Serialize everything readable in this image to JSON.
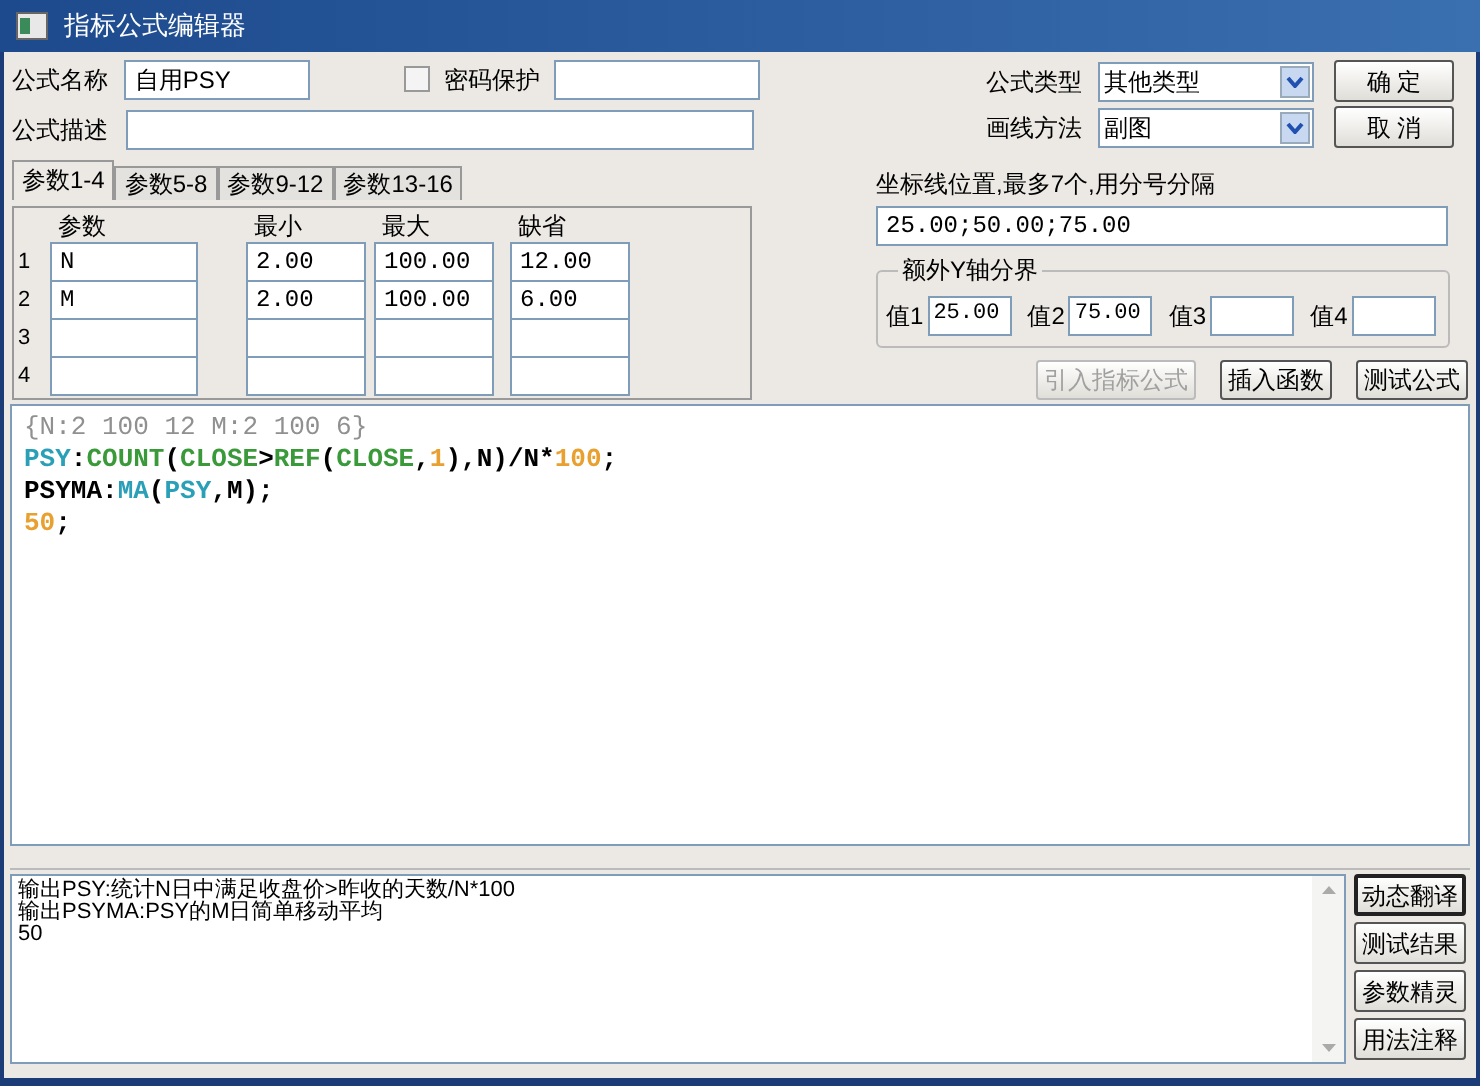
{
  "window": {
    "title": "指标公式编辑器"
  },
  "formula": {
    "name_label": "公式名称",
    "name_value": "自用PSY",
    "password": {
      "label": "密码保护",
      "checked": false
    },
    "description_label": "公式描述"
  },
  "param_tabs": [
    {
      "label": "参数1-4",
      "selected": true
    },
    {
      "label": "参数5-8",
      "selected": false
    },
    {
      "label": "参数9-12",
      "selected": false
    },
    {
      "label": "参数13-16",
      "selected": false
    }
  ],
  "param_table": {
    "columns": [
      "参数",
      "最小",
      "最大",
      "缺省"
    ],
    "rows": [
      {
        "index": "1",
        "cells": [
          "N",
          "2.00",
          "100.00",
          "12.00"
        ]
      },
      {
        "index": "2",
        "cells": [
          "M",
          "2.00",
          "100.00",
          "6.00"
        ]
      },
      {
        "index": "3"
      },
      {
        "index": "4"
      }
    ]
  },
  "formula_type": {
    "label": "公式类型",
    "value": "其他类型"
  },
  "draw_method": {
    "label": "画线方法",
    "value": "副图"
  },
  "dialog_buttons": [
    {
      "label": "确 定"
    },
    {
      "label": "取 消"
    }
  ],
  "axis_lines": {
    "label": "坐标线位置,最多7个,用分号分隔",
    "value": "25.00;50.00;75.00"
  },
  "extra_y": {
    "title": "额外Y轴分界",
    "fields": [
      {
        "label": "值1",
        "value": "25.00"
      },
      {
        "label": "值2",
        "value": "75.00"
      },
      {
        "label": "值3"
      },
      {
        "label": "值4"
      }
    ]
  },
  "tool_buttons": [
    {
      "label": "引入指标公式",
      "disabled": true
    },
    {
      "label": "插入函数",
      "disabled": false
    },
    {
      "label": "测试公式",
      "disabled": false
    }
  ],
  "code_lines": [
    [
      {
        "text": "{N:2 100 12 M:2 100 6}",
        "kind": "comment"
      }
    ],
    [
      {
        "text": "PSY",
        "kind": "output"
      },
      {
        "text": ":",
        "kind": "plain"
      },
      {
        "text": "COUNT",
        "kind": "func"
      },
      {
        "text": "(",
        "kind": "plain"
      },
      {
        "text": "CLOSE",
        "kind": "func"
      },
      {
        "text": ">",
        "kind": "plain"
      },
      {
        "text": "REF",
        "kind": "func"
      },
      {
        "text": "(",
        "kind": "plain"
      },
      {
        "text": "CLOSE",
        "kind": "func"
      },
      {
        "text": ",",
        "kind": "plain"
      },
      {
        "text": "1",
        "kind": "number"
      },
      {
        "text": "),N)/N*",
        "kind": "plain"
      },
      {
        "text": "100",
        "kind": "number"
      },
      {
        "text": ";",
        "kind": "plain"
      }
    ],
    [
      {
        "text": "PSYMA:",
        "kind": "plain"
      },
      {
        "text": "MA",
        "kind": "output"
      },
      {
        "text": "(",
        "kind": "plain"
      },
      {
        "text": "PSY",
        "kind": "output"
      },
      {
        "text": ",M);",
        "kind": "plain"
      }
    ],
    [
      {
        "text": "50",
        "kind": "number"
      },
      {
        "text": ";",
        "kind": "plain"
      }
    ]
  ],
  "output_lines": [
    "输出PSY:统计N日中满足收盘价>昨收的天数/N*100",
    "输出PSYMA:PSY的M日简单移动平均",
    "50"
  ],
  "side_buttons": [
    {
      "label": "动态翻译",
      "selected": true
    },
    {
      "label": "测试结果",
      "selected": false
    },
    {
      "label": "参数精灵",
      "selected": false
    },
    {
      "label": "用法注释",
      "selected": false
    }
  ]
}
